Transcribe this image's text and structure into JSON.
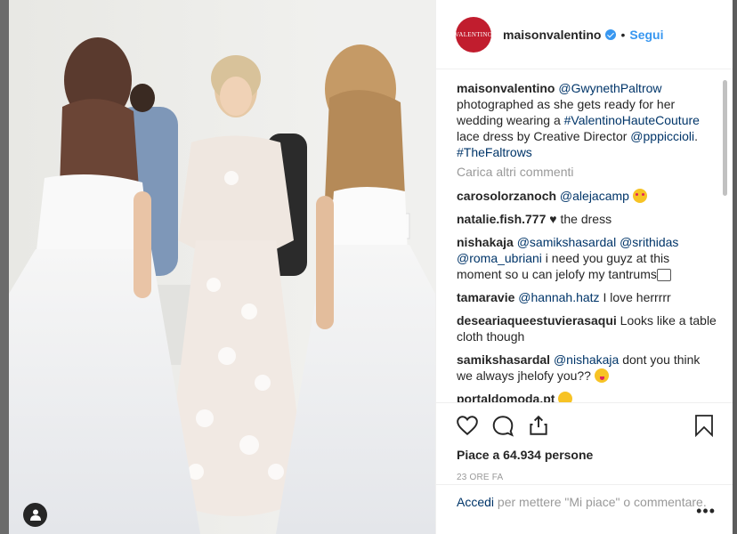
{
  "post": {
    "avatar_text": "VALENTINO",
    "username": "maisonvalentino",
    "separator": "•",
    "follow_label": "Segui"
  },
  "caption": {
    "username": "maisonvalentino",
    "mention1": "@GwynethPaltrow",
    "text1": " photographed as she gets ready for her wedding wearing a ",
    "hashtag1": "#ValentinoHauteCouture",
    "text2": " lace dress by Creative Director ",
    "mention2": "@pppiccioli",
    "text3": ". ",
    "hashtag2": "#TheFaltrows"
  },
  "load_more_label": "Carica altri commenti",
  "comments": [
    {
      "user": "carosolorzanoch",
      "mention": "@alejacamp",
      "text": " ",
      "emoji": "smiling-hearts"
    },
    {
      "user": "natalie.fish.777",
      "mention": "",
      "text": " ♥ the dress",
      "emoji": ""
    },
    {
      "user": "nishakaja",
      "mention": "@samikshasardal @srithidas @roma_ubriani",
      "text": " i need you guyz at this moment so u can jelofy my tantrums",
      "emoji": "ticket"
    },
    {
      "user": "tamaravie",
      "mention": "@hannah.hatz",
      "text": " I love herrrrr",
      "emoji": ""
    },
    {
      "user": "deseariaqueestuvierasaqui",
      "mention": "",
      "text": " Looks like a table cloth though",
      "emoji": ""
    },
    {
      "user": "samikshasardal",
      "mention": "@nishakaja",
      "text": " dont you think we always jhelofy you?? ",
      "emoji": "tongue"
    },
    {
      "user": "portaldomoda.pt",
      "mention": "",
      "text": " ",
      "emoji": "clap"
    }
  ],
  "icons": {
    "like": "heart-icon",
    "comment": "comment-icon",
    "share": "share-icon",
    "save": "bookmark-icon",
    "tag": "user-tag-icon",
    "more": "more-options-icon"
  },
  "likes_text": "Piace a 64.934 persone",
  "timestamp": "23 ORE FA",
  "login": {
    "link": "Accedi",
    "text": " per mettere \"Mi piace\" o commentare."
  },
  "more_label": "•••",
  "colors": {
    "link": "#003569",
    "follow": "#3897f0",
    "brand": "#c11d2e",
    "muted": "#999999"
  }
}
